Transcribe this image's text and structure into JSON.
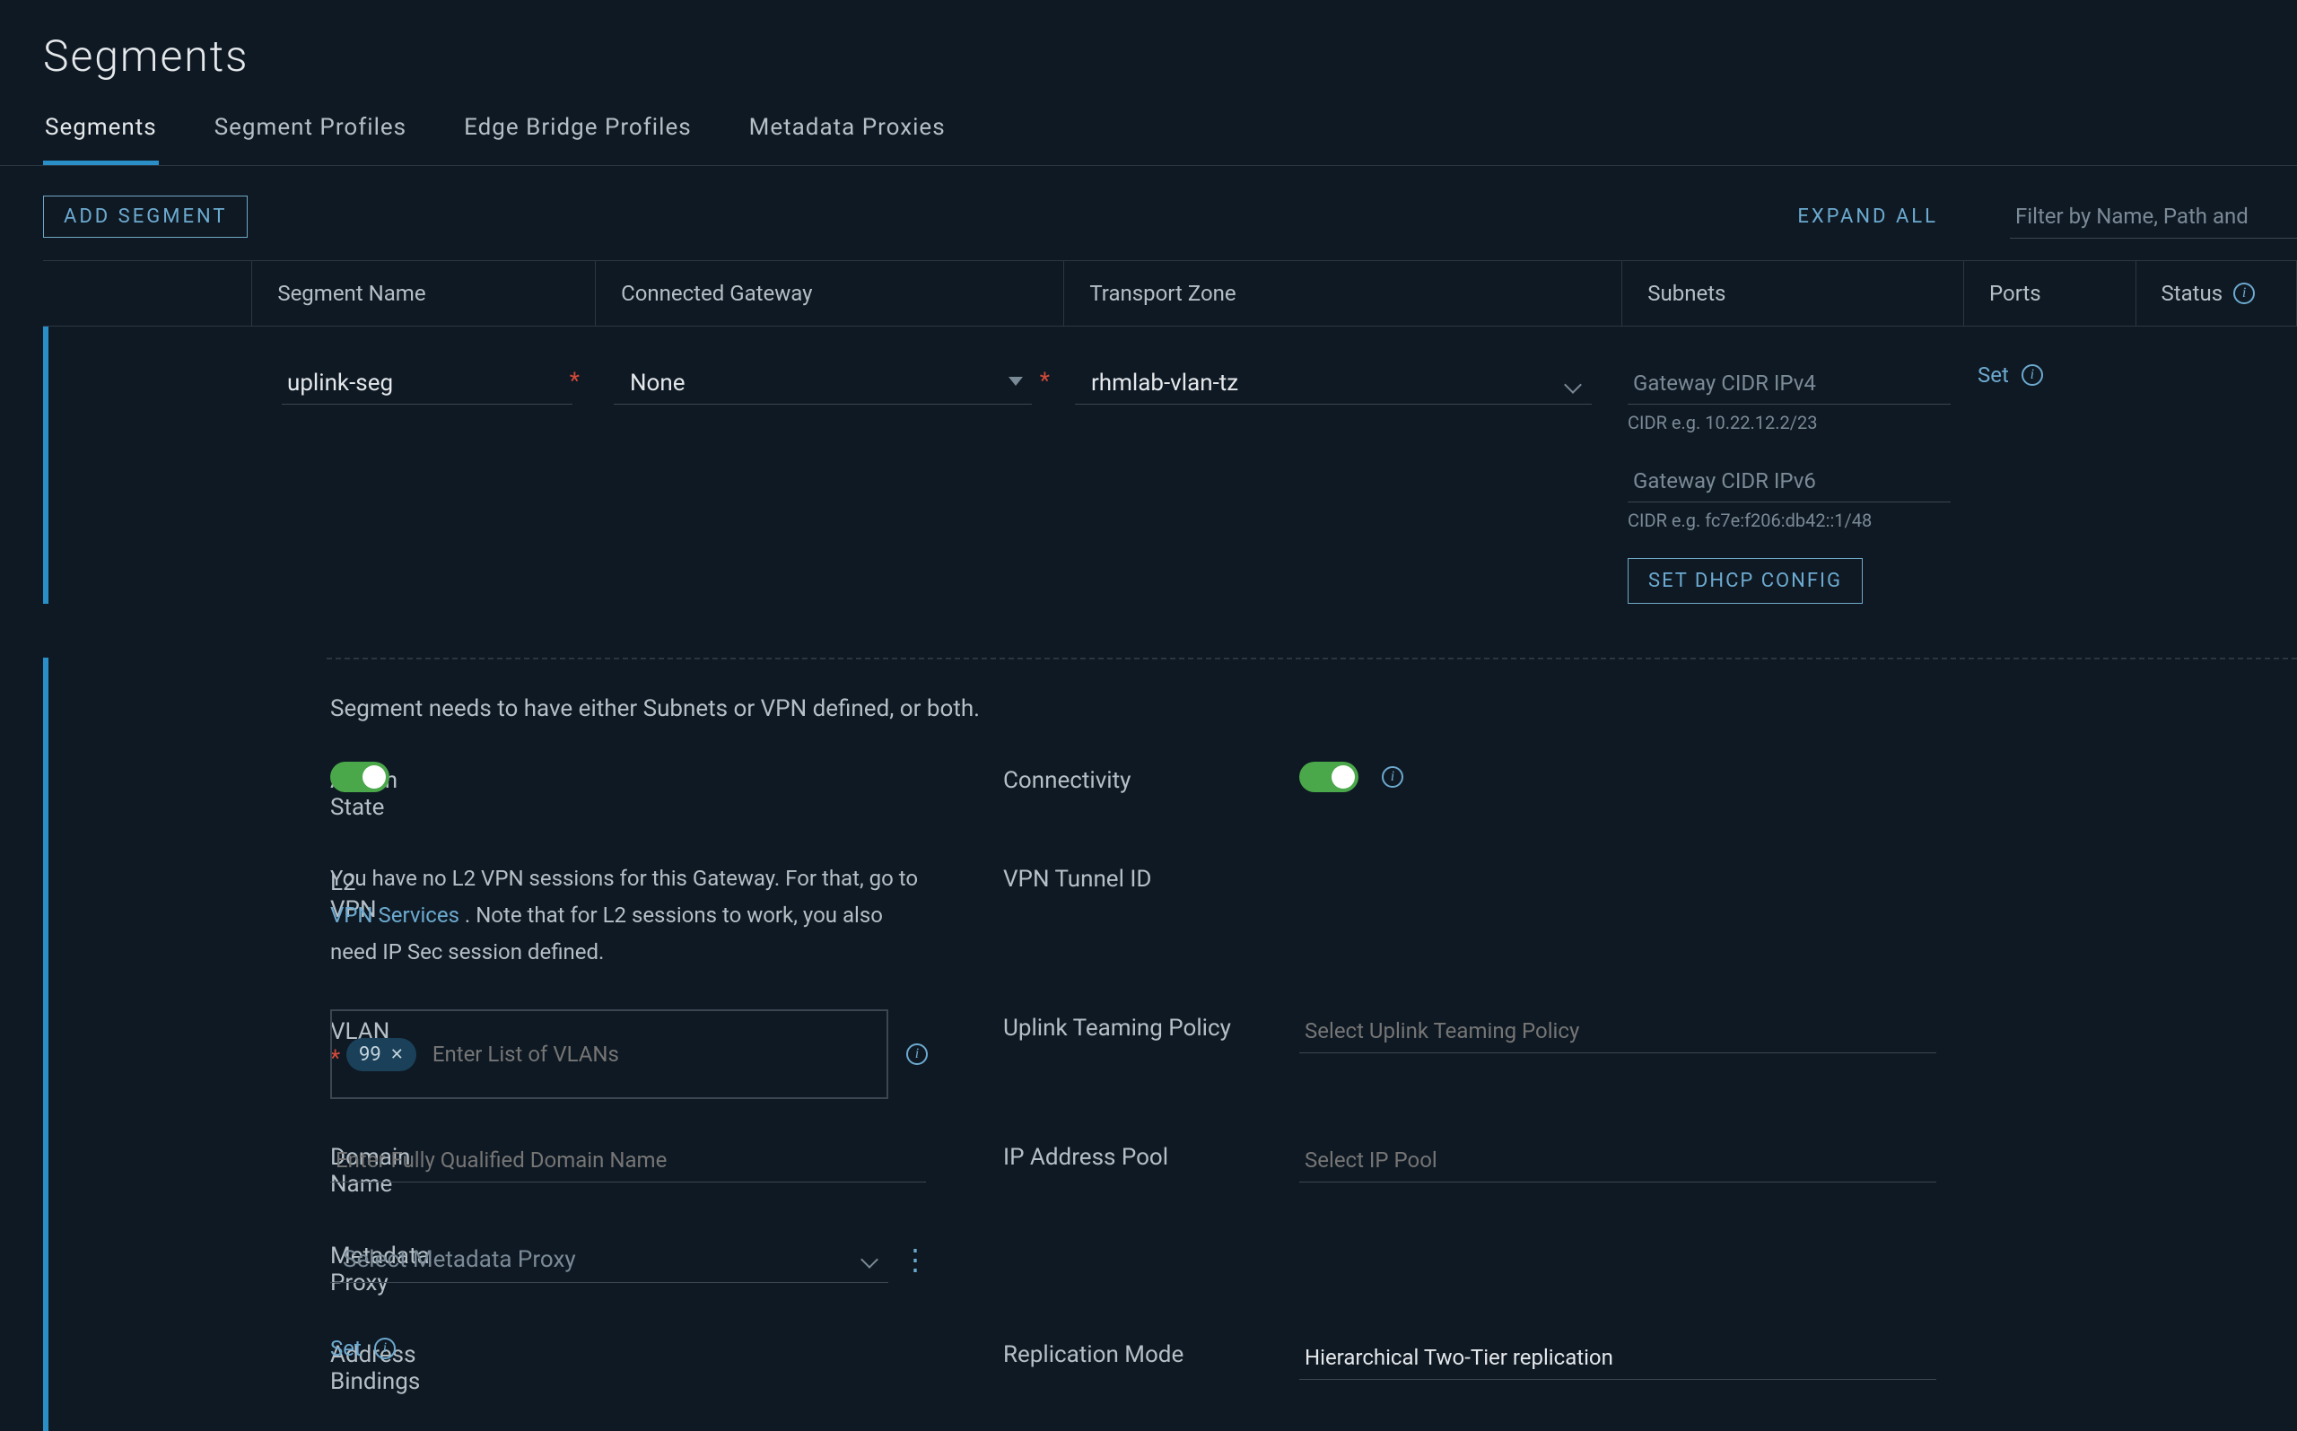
{
  "page": {
    "title": "Segments"
  },
  "tabs": {
    "segments": "Segments",
    "profiles": "Segment Profiles",
    "edge": "Edge Bridge Profiles",
    "metadata": "Metadata Proxies"
  },
  "toolbar": {
    "add": "ADD SEGMENT",
    "expand_all": "EXPAND ALL",
    "filter_placeholder": "Filter by Name, Path and"
  },
  "columns": {
    "name": "Segment Name",
    "gateway": "Connected Gateway",
    "tz": "Transport Zone",
    "subnets": "Subnets",
    "ports": "Ports",
    "status": "Status"
  },
  "edit_row": {
    "name_value": "uplink-seg",
    "gateway_value": "None",
    "tz_value": "rhmlab-vlan-tz",
    "ipv4_placeholder": "Gateway CIDR IPv4",
    "ipv4_hint": "CIDR e.g. 10.22.12.2/23",
    "ipv6_placeholder": "Gateway CIDR IPv6",
    "ipv6_hint": "CIDR e.g. fc7e:f206:db42::1/48",
    "dhcp_button": "SET DHCP CONFIG",
    "ports_set": "Set"
  },
  "helper": "Segment needs to have either Subnets or VPN defined, or both.",
  "settings": {
    "admin_state": "Admin State",
    "connectivity": "Connectivity",
    "l2vpn": "L2 VPN",
    "l2vpn_text_1": "You have no L2 VPN sessions for this Gateway. For that, go to ",
    "l2vpn_link": "VPN Services",
    "l2vpn_text_2": " . Note that for L2 sessions to work, you also need IP Sec session defined.",
    "vpn_tunnel": "VPN Tunnel ID",
    "vlan": "VLAN",
    "vlan_chip": "99",
    "vlan_placeholder": "Enter List of VLANs",
    "uplink_policy": "Uplink Teaming Policy",
    "uplink_placeholder": "Select Uplink Teaming Policy",
    "domain": "Domain Name",
    "domain_placeholder": "Enter Fully Qualified Domain Name",
    "ip_pool": "IP Address Pool",
    "ip_pool_placeholder": "Select IP Pool",
    "meta_proxy": "Metadata Proxy",
    "meta_proxy_placeholder": "Select Metadata Proxy",
    "address_bindings": "Address Bindings",
    "set": "Set",
    "replication": "Replication Mode",
    "replication_value": "Hierarchical Two-Tier replication"
  }
}
